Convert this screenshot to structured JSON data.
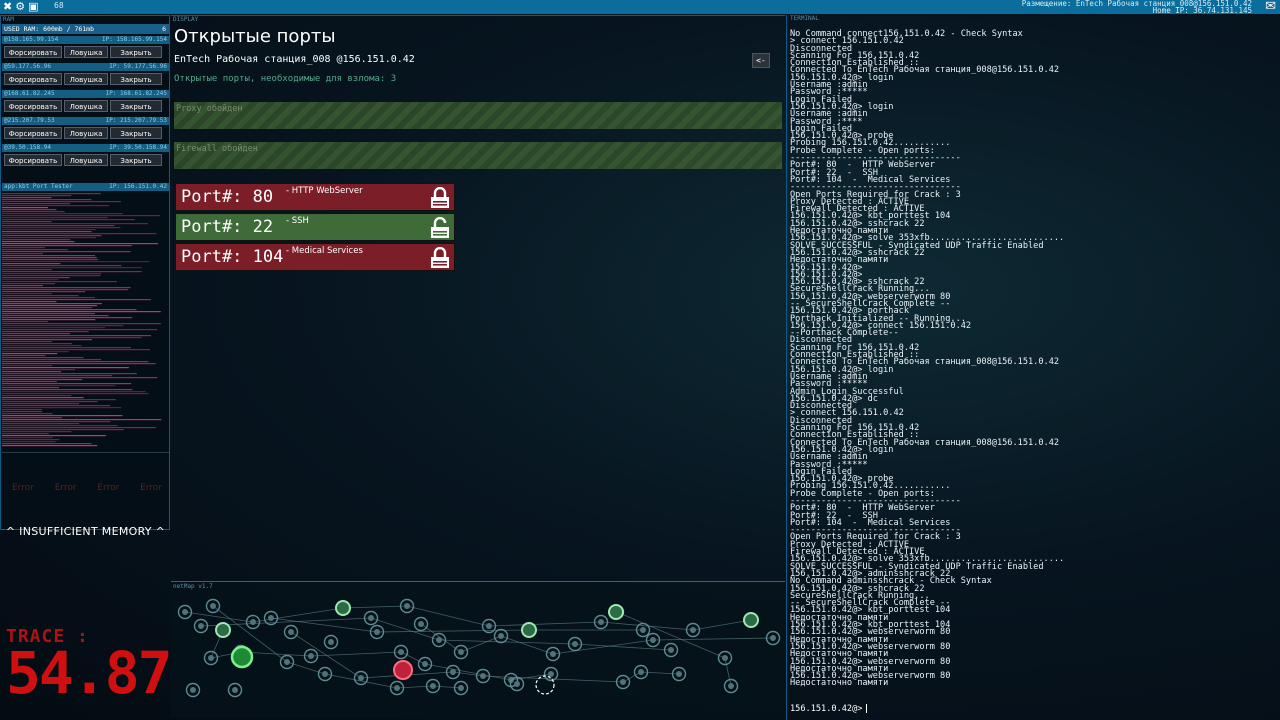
{
  "topbar": {
    "icons": [
      "close-icon",
      "gear-icon",
      "save-icon"
    ],
    "ram_counter": "68",
    "location_line": "Размещение: EnTech Рабочая станция_008@156.151.0.42",
    "home_line": "Home IP: 36.74.131.145",
    "mail_icon": "mail-icon"
  },
  "ram": {
    "panel_title": "RAM",
    "usage_label": "USED RAM: 600mb / 761mb",
    "usage_count": "6",
    "exes": [
      {
        "header": "@158.165.99.154",
        "ip": "IP: 158.165.99.154",
        "force": "Форсировать",
        "trap": "Ловушка",
        "close": "Закрыть"
      },
      {
        "header": "@59.177.56.96",
        "ip": "IP: 59.177.56.96",
        "force": "Форсировать",
        "trap": "Ловушка",
        "close": "Закрыть"
      },
      {
        "header": "@168.61.82.245",
        "ip": "IP: 168.61.82.245",
        "force": "Форсировать",
        "trap": "Ловушка",
        "close": "Закрыть"
      },
      {
        "header": "@215.207.79.53",
        "ip": "IP: 215.207.79.53",
        "force": "Форсировать",
        "trap": "Ловушка",
        "close": "Закрыть"
      },
      {
        "header": "@39.50.158.94",
        "ip": "IP: 39.50.158.94",
        "force": "Форсировать",
        "trap": "Ловушка",
        "close": "Закрыть"
      }
    ],
    "porttester_header": "app:kbt Port Tester",
    "porttester_ip": "IP: 156.151.0.42",
    "errors": [
      "Error",
      "Error",
      "Error",
      "Error"
    ],
    "insufficient": "^ INSUFFICIENT MEMORY ^"
  },
  "trace": {
    "label": "TRACE :",
    "value": "54.87"
  },
  "display": {
    "panel_title": "DISPLAY",
    "title": "Открытые порты",
    "subtitle": "EnTech Рабочая станция_008 @156.151.0.42",
    "required": "Открытые порты, необходимые для взлома: 3",
    "back_label": "<-",
    "bypass": [
      "Proxy обойден",
      "Firewall обойден"
    ],
    "ports": [
      {
        "label": "Port#: 80",
        "service": "- HTTP WebServer",
        "state": "closed",
        "color": "#7c1e27"
      },
      {
        "label": "Port#: 22",
        "service": "- SSH",
        "state": "open",
        "color": "#3e6b38"
      },
      {
        "label": "Port#: 104",
        "service": "- Medical Services",
        "state": "closed",
        "color": "#7c1e27"
      }
    ]
  },
  "netmap": {
    "panel_title": "netMap v1.7"
  },
  "terminal": {
    "panel_title": "TERMINAL",
    "lines": [
      "No Command connect156.151.0.42 - Check Syntax",
      "> connect 156.151.0.42",
      "Disconnected",
      "Scanning For 156.151.0.42",
      "Connection Established ::",
      "Connected To EnTech Рабочая станция_008@156.151.0.42",
      "156.151.0.42@> login",
      "Username :admin",
      "Password :*****",
      "Login Failed",
      "156.151.0.42@> login",
      "Username :admin",
      "Password :****",
      "Login Failed",
      "156.151.0.42@> probe",
      "Probing 156.151.0.42...........",
      "Probe Complete - Open ports:",
      "---------------------------------",
      "Port#: 80  -  HTTP WebServer",
      "Port#: 22  -  SSH",
      "Port#: 104  -  Medical Services",
      "---------------------------------",
      "Open Ports Required for Crack : 3",
      "Proxy Detected : ACTIVE",
      "Firewall Detected : ACTIVE",
      "156.151.0.42@> kbt_porttest 104",
      "156.151.0.42@> sshcrack 22",
      "Недостаточно памяти",
      "156.151.0.42@> solve 353xfb..........................",
      "SOLVE SUCCESSFUL - Syndicated UDP Traffic Enabled",
      "156.151.0.42@> sshcrack 22",
      "Недостаточно памяти",
      "156.151.0.42@>",
      "156.151.0.42@>",
      "156.151.0.42@> sshcrack 22",
      "SecureShellCrack Running...",
      "156.151.0.42@> webserverworm 80",
      "-- SecureShellCrack Complete --",
      "156.151.0.42@> porthack",
      "Porthack Initialized -- Running...",
      "156.151.0.42@> connect 156.151.0.42",
      "--Porthack Complete--",
      "Disconnected",
      "Scanning For 156.151.0.42",
      "Connection Established ::",
      "Connected To EnTech Рабочая станция_008@156.151.0.42",
      "156.151.0.42@> login",
      "Username :admin",
      "Password :*****",
      "Admin Login Successful",
      "156.151.0.42@> dc",
      "Disconnected",
      "> connect 156.151.0.42",
      "Disconnected",
      "Scanning For 156.151.0.42",
      "Connection Established ::",
      "Connected To EnTech Рабочая станция_008@156.151.0.42",
      "156.151.0.42@> login",
      "Username :admin",
      "Password :*****",
      "Login Failed",
      "156.151.0.42@> probe",
      "Probing 156.151.0.42...........",
      "Probe Complete - Open ports:",
      "---------------------------------",
      "Port#: 80  -  HTTP WebServer",
      "Port#: 22  -  SSH",
      "Port#: 104  -  Medical Services",
      "---------------------------------",
      "Open Ports Required for Crack : 3",
      "Proxy Detected : ACTIVE",
      "Firewall Detected : ACTIVE",
      "156.151.0.42@> solve 353xfb..........................",
      "SOLVE SUCCESSFUL - Syndicated UDP Traffic Enabled",
      "156.151.0.42@> adminsshcrack 22",
      "No Command adminsshcrack - Check Syntax",
      "156.151.0.42@> sshcrack 22",
      "SecureShellCrack Running...",
      "-- SecureShellCrack Complete --",
      "156.151.0.42@> kbt_porttest 104",
      "Недостаточно памяти",
      "156.151.0.42@> kbt_porttest 104",
      "156.151.0.42@> webserverworm 80",
      "Недостаточно памяти",
      "156.151.0.42@> webserverworm 80",
      "Недостаточно памяти",
      "156.151.0.42@> webserverworm 80",
      "Недостаточно памяти",
      "156.151.0.42@> webserverworm 80",
      "Недостаточно памяти"
    ],
    "prompt": "156.151.0.42@>"
  }
}
